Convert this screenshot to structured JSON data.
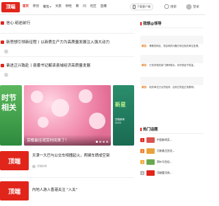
{
  "header": {
    "logo_text": "顶端",
    "nav": [
      {
        "label": "首页",
        "active": true,
        "caret": false
      },
      {
        "label": "原创",
        "active": false,
        "caret": false
      },
      {
        "label": "聚焦",
        "active": false,
        "caret": true
      },
      {
        "label": "文旅",
        "active": false,
        "caret": false
      },
      {
        "label": "财经",
        "active": false,
        "caret": false
      },
      {
        "label": "教",
        "active": false,
        "caret": false
      },
      {
        "label": "问",
        "active": false,
        "caret": false
      },
      {
        "label": "社区",
        "active": false,
        "caret": false
      },
      {
        "label": "直播",
        "active": false,
        "caret": false
      }
    ],
    "app_label": "下载客户端",
    "search_label": "搜索",
    "login_label": "登录"
  },
  "headlines": [
    "信心·砥岩前行",
    "新思想引领新征程丨以新质生产力为高质量发展注入强大动力",
    "奋进正兴致赴丨县委书记解读县域经济高质量发展"
  ],
  "headline_sub": "",
  "carousel": {
    "left_text": "时节\n相关",
    "main_caption": "赏樱最佳观赏时间来了！",
    "right_title": "新星",
    "right_sub": "顶端新闻\n2024"
  },
  "cards": [
    {
      "thumb": "顶端",
      "title": "天津一大巴与公交车相撞起火，两辆车燃成空架",
      "source": "顶端新闻"
    },
    {
      "thumb": "顶端",
      "title": "内地人游入香港关注 \"入关\"",
      "source": ""
    }
  ],
  "right": {
    "question_panel_title": "我想@领导",
    "questions": [
      {
        "tag": "提问：",
        "text": "洛阳市二零九公路安全改造问题"
      },
      {
        "tag": "解答：",
        "text": "尊敬的网友，您反映的问题已转交相关单位处理，感谢您的关注和支持。",
        "reply": true
      },
      {
        "tag": "提问：",
        "text": "关于小区停车位紧张问题的反映"
      },
      {
        "tag": "解答：",
        "text": "已安排相关部门调研核实，将尽快给予答复。",
        "reply": true
      },
      {
        "tag": "提问：",
        "text": "二七区人民路路灯损坏"
      },
      {
        "tag": "解答：",
        "text": "相关单位已派员检修，目前已恢复正常照明。",
        "reply": true
      }
    ],
    "hot_panel_title": "热门话题",
    "hot": [
      {
        "rank": "1",
        "text": "中国新闻奖..."
      },
      {
        "rank": "2",
        "text": "河南春日赏花..."
      },
      {
        "rank": "3",
        "text": "郑州马拉松..."
      },
      {
        "rank": "4",
        "text": "顶端看河南..."
      }
    ]
  },
  "colors": {
    "brand": "#e1251b",
    "slide_left": "#3ea34d",
    "slide_right": "#1f7a5e"
  }
}
